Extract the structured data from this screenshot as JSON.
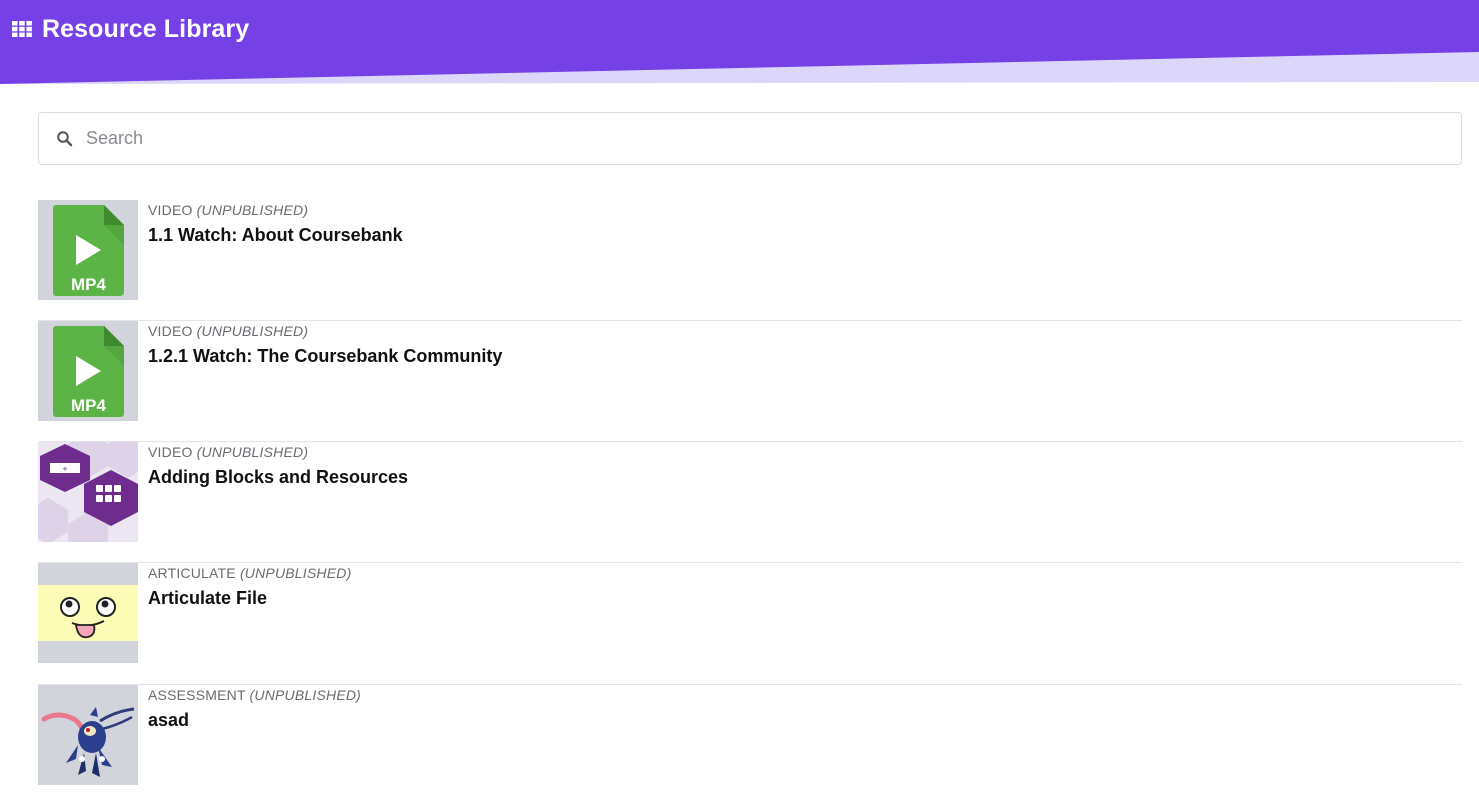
{
  "header": {
    "title": "Resource Library",
    "icon": "grid-icon",
    "brand_color": "#7540e6",
    "accent_light": "#ddd6fb"
  },
  "search": {
    "placeholder": "Search",
    "value": "",
    "icon": "search-icon"
  },
  "resources": [
    {
      "type": "VIDEO",
      "status": "(UNPUBLISHED)",
      "title": "1.1 Watch: About Coursebank",
      "thumbnail": "mp4-file-icon"
    },
    {
      "type": "VIDEO",
      "status": "(UNPUBLISHED)",
      "title": "1.2.1 Watch: The Coursebank Community",
      "thumbnail": "mp4-file-icon"
    },
    {
      "type": "VIDEO",
      "status": "(UNPUBLISHED)",
      "title": "Adding Blocks and Resources",
      "thumbnail": "hexagon-blocks-thumbnail"
    },
    {
      "type": "ARTICULATE",
      "status": "(UNPUBLISHED)",
      "title": "Articulate File",
      "thumbnail": "silly-face-thumbnail"
    },
    {
      "type": "ASSESSMENT",
      "status": "(UNPUBLISHED)",
      "title": "asad",
      "thumbnail": "creature-thumbnail"
    }
  ],
  "mp4_label": "MP4"
}
